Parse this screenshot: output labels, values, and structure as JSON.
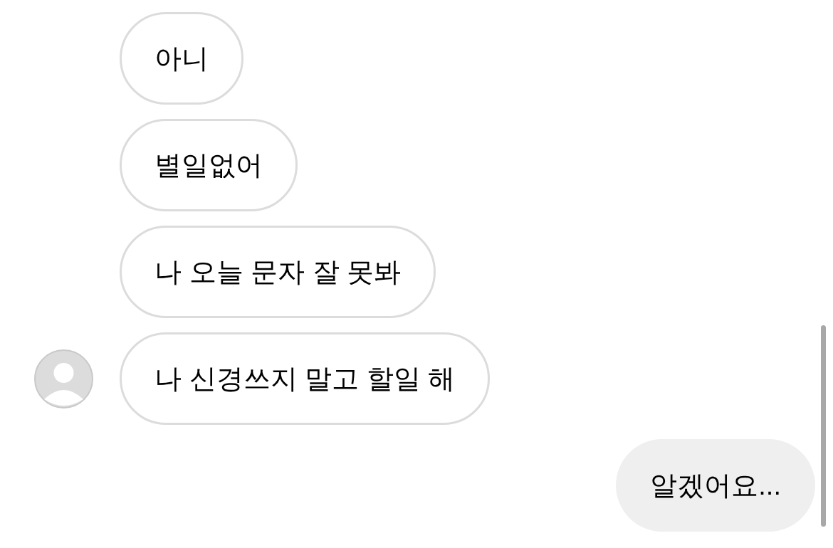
{
  "messages": [
    {
      "kind": "received",
      "text": "아니"
    },
    {
      "kind": "received",
      "text": "별일없어"
    },
    {
      "kind": "received",
      "text": "나 오늘 문자 잘 못봐"
    },
    {
      "kind": "received",
      "text": "나 신경쓰지 말고 할일 해"
    },
    {
      "kind": "sent",
      "text": "알겠어요..."
    }
  ]
}
